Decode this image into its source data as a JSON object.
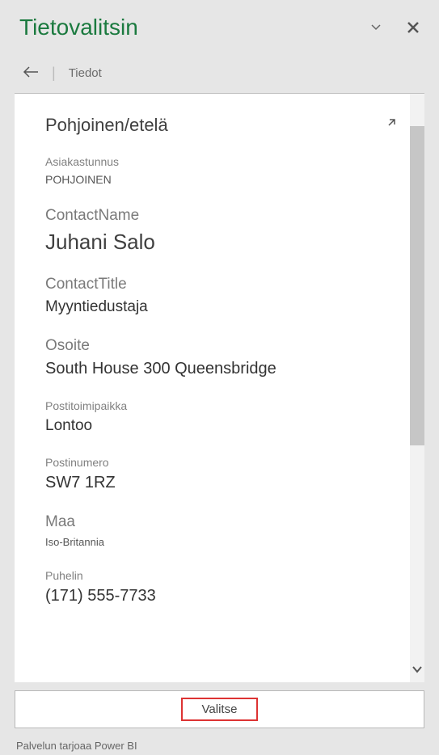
{
  "header": {
    "title": "Tietovalitsin"
  },
  "breadcrumb": {
    "label": "Tiedot"
  },
  "record": {
    "title": "Pohjoinen/etelä",
    "fields": [
      {
        "label": "Asiakastunnus",
        "value": "POHJOINEN",
        "labelClass": "",
        "valueClass": "small"
      },
      {
        "label": "ContactName",
        "value": "Juhani Salo",
        "labelClass": "large",
        "valueClass": "large"
      },
      {
        "label": "ContactTitle",
        "value": "Myyntiedustaja",
        "labelClass": "large",
        "valueClass": "mid"
      },
      {
        "label": "Osoite",
        "value": "South House 300 Queensbridge",
        "labelClass": "large",
        "valueClass": ""
      },
      {
        "label": "Postitoimipaikka",
        "value": "Lontoo",
        "labelClass": "",
        "valueClass": "mid"
      },
      {
        "label": "Postinumero",
        "value": "SW7 1RZ",
        "labelClass": "",
        "valueClass": ""
      },
      {
        "label": "Maa",
        "value": "Iso-Britannia",
        "labelClass": "large",
        "valueClass": "tiny"
      },
      {
        "label": "Puhelin",
        "value": "(171) 555-7733",
        "labelClass": "",
        "valueClass": ""
      }
    ]
  },
  "actions": {
    "select_label": "Valitse"
  },
  "footer": {
    "text": "Palvelun tarjoaa Power BI"
  }
}
